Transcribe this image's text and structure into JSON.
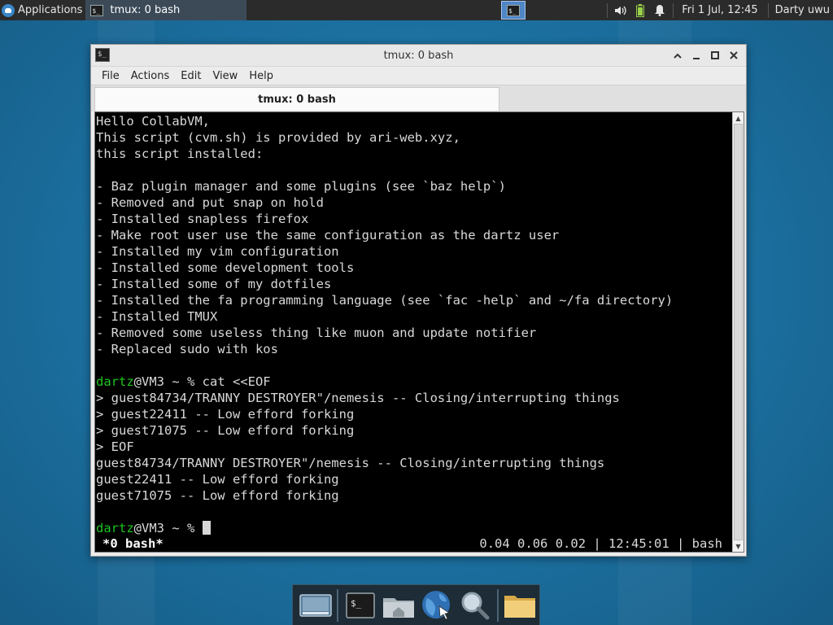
{
  "panel": {
    "apps_label": "Applications",
    "task_label": "tmux: 0 bash",
    "clock": "Fri  1 Jul, 12:45",
    "user": "Darty uwu"
  },
  "window": {
    "title": "tmux: 0 bash",
    "menu": [
      "File",
      "Actions",
      "Edit",
      "View",
      "Help"
    ],
    "tab_label": "tmux: 0 bash"
  },
  "terminal": {
    "lines": [
      {
        "text": "Hello CollabVM,"
      },
      {
        "text": "This script (cvm.sh) is provided by ari-web.xyz,"
      },
      {
        "text": "this script installed:"
      },
      {
        "text": ""
      },
      {
        "text": "- Baz plugin manager and some plugins (see `baz help`)"
      },
      {
        "text": "- Removed and put snap on hold"
      },
      {
        "text": "- Installed snapless firefox"
      },
      {
        "text": "- Make root user use the same configuration as the dartz user"
      },
      {
        "text": "- Installed my vim configuration"
      },
      {
        "text": "- Installed some development tools"
      },
      {
        "text": "- Installed some of my dotfiles"
      },
      {
        "text": "- Installed the fa programming language (see `fac -help` and ~/fa directory)"
      },
      {
        "text": "- Installed TMUX"
      },
      {
        "text": "- Removed some useless thing like muon and update notifier"
      },
      {
        "text": "- Replaced sudo with kos"
      },
      {
        "text": ""
      },
      {
        "user": "dartz",
        "text": "@VM3 ~ % cat <<EOF"
      },
      {
        "text": "> guest84734/TRANNY DESTROYER\"/nemesis -- Closing/interrupting things"
      },
      {
        "text": "> guest22411 -- Low efford forking"
      },
      {
        "text": "> guest71075 -- Low efford forking"
      },
      {
        "text": "> EOF"
      },
      {
        "text": "guest84734/TRANNY DESTROYER\"/nemesis -- Closing/interrupting things"
      },
      {
        "text": "guest22411 -- Low efford forking"
      },
      {
        "text": "guest71075 -- Low efford forking"
      },
      {
        "text": ""
      },
      {
        "user": "dartz",
        "text": "@VM3 ~ % ",
        "cursor": true
      }
    ],
    "status_left": "*0 bash*",
    "status_right": "0.04 0.06 0.02 | 12:45:01 | bash"
  },
  "dock": {
    "items": [
      {
        "name": "show-desktop-icon"
      },
      {
        "name": "terminal-icon"
      },
      {
        "name": "home-folder-icon"
      },
      {
        "name": "web-browser-icon"
      },
      {
        "name": "search-icon"
      },
      {
        "name": "folder-icon"
      }
    ]
  },
  "colors": {
    "prompt_user": "#1ec41e",
    "terminal_bg": "#000000",
    "terminal_fg": "#d8d8d8",
    "panel_bg": "#2b2b2b"
  }
}
